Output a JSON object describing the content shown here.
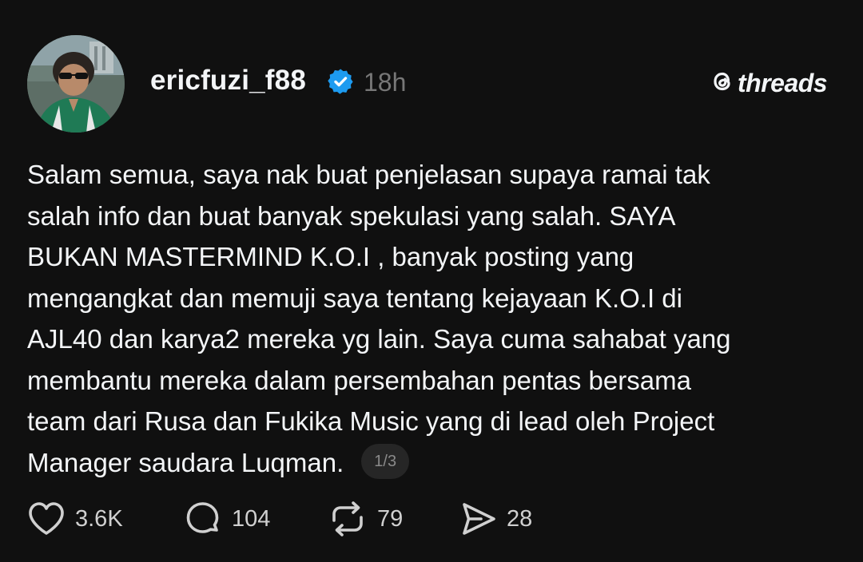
{
  "author": {
    "username": "ericfuzi_f88",
    "verified": true,
    "timestamp": "18h"
  },
  "brand": {
    "name": "threads"
  },
  "post": {
    "lines": [
      "Salam semua, saya nak buat penjelasan supaya ramai tak",
      "salah info dan buat banyak spekulasi yang salah. SAYA",
      "BUKAN MASTERMIND K.O.I , banyak posting yang",
      "mengangkat dan memuji saya tentang kejayaan K.O.I di",
      "AJL40 dan karya2 mereka yg lain. Saya cuma sahabat yang",
      "membantu mereka dalam persembahan pentas bersama",
      "team dari Rusa dan Fukika Music yang di lead oleh Project",
      "Manager saudara Luqman."
    ],
    "page_indicator": "1/3"
  },
  "actions": {
    "likes": "3.6K",
    "replies": "104",
    "reposts": "79",
    "shares": "28"
  },
  "icons": {
    "like": "heart-icon",
    "reply": "speech-bubble-icon",
    "repost": "repost-icon",
    "share": "send-icon",
    "verified": "verified-badge-icon",
    "brand": "threads-logo-icon"
  },
  "colors": {
    "background": "#101010",
    "text": "#f3f5f7",
    "muted": "#777777",
    "verified": "#1d9bf0"
  }
}
